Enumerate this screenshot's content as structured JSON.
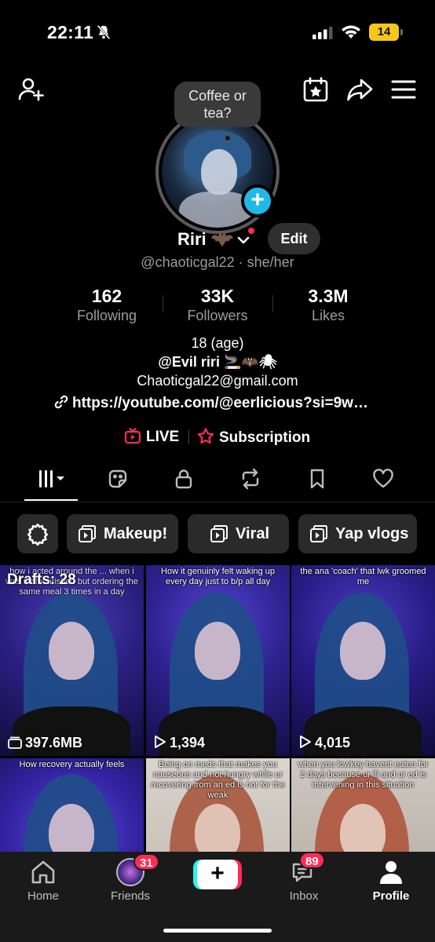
{
  "status_bar": {
    "time": "22:11",
    "battery": "14"
  },
  "bubble": {
    "text": "Coffee or tea?"
  },
  "profile": {
    "display_name": "Riri",
    "handle": "@chaoticgal22 · she/her",
    "edit_label": "Edit"
  },
  "stats": [
    {
      "value": "162",
      "label": "Following"
    },
    {
      "value": "33K",
      "label": "Followers"
    },
    {
      "value": "3.3M",
      "label": "Likes"
    }
  ],
  "bio": {
    "line1": "18 (age)",
    "line2": "@Evil riri 🚬🦇🕷",
    "line3": "Chaoticgal22@gmail.com",
    "link": "https://youtube.com/@eerlicious?si=9w…"
  },
  "actions": {
    "live": "LIVE",
    "subscription": "Subscription"
  },
  "playlists": [
    "Makeup!",
    "Viral",
    "Yap vlogs"
  ],
  "videos": [
    {
      "caption": "how i acted around the ... when i was malnourished but ordering the same meal 3 times in a day",
      "overlay": "Drafts: 28",
      "stat": "397.6MB"
    },
    {
      "caption": "How it genuinly felt waking up every day just to b/p all day",
      "stat": "1,394"
    },
    {
      "caption": "the ana 'coach' that lwk groomed me",
      "stat": "4,015"
    },
    {
      "caption": "How recovery actually feels"
    },
    {
      "caption": "Being on meds that makes you nauseous and not hungry while ur recovering from an ed is not for the weak"
    },
    {
      "caption": "when you lowkey havent eaten for 2 days because ur ill and ur ed is intervening in this situation"
    }
  ],
  "nav": {
    "home": "Home",
    "friends": "Friends",
    "friends_badge": "31",
    "inbox": "Inbox",
    "inbox_badge": "89",
    "profile": "Profile"
  },
  "colors": {
    "accent": "#fe2c55",
    "cyan": "#25f4ee",
    "add_blue": "#20b8e8",
    "chip_bg": "#2a2a2a"
  }
}
